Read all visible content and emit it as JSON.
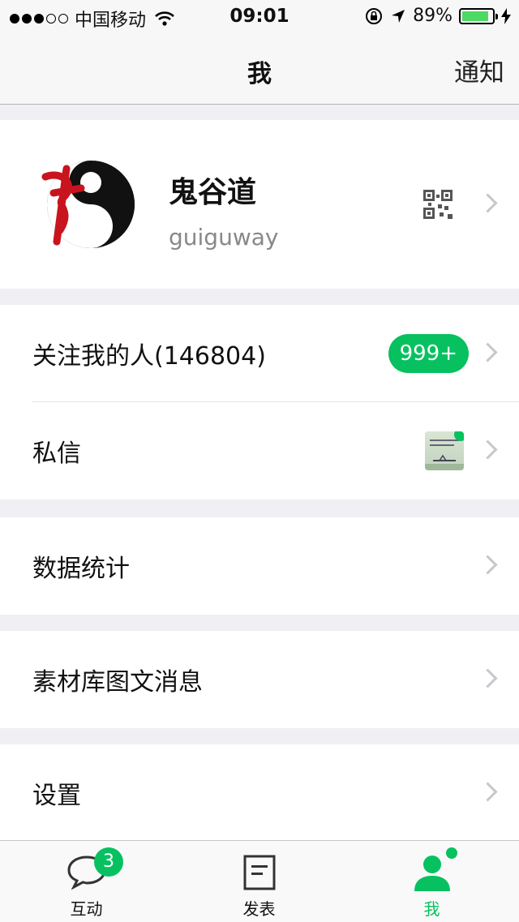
{
  "status_bar": {
    "carrier": "中国移动",
    "time": "09:01",
    "battery": "89%",
    "battery_level": 0.89,
    "signal_bars_filled": 3,
    "signal_bars_total": 5
  },
  "nav": {
    "title": "我",
    "right_button": "通知"
  },
  "profile": {
    "name": "鬼谷道",
    "username": "guiguway"
  },
  "menu": {
    "followers": {
      "label": "关注我的人(146804)",
      "badge": "999+"
    },
    "messages": {
      "label": "私信"
    },
    "stats": {
      "label": "数据统计"
    },
    "materials": {
      "label": "素材库图文消息"
    },
    "settings": {
      "label": "设置"
    }
  },
  "tabbar": {
    "interact": {
      "label": "互动",
      "badge": "3"
    },
    "publish": {
      "label": "发表"
    },
    "me": {
      "label": "我"
    }
  },
  "colors": {
    "accent": "#07c160",
    "background": "#efeff4",
    "avatar_red": "#c8141e"
  }
}
